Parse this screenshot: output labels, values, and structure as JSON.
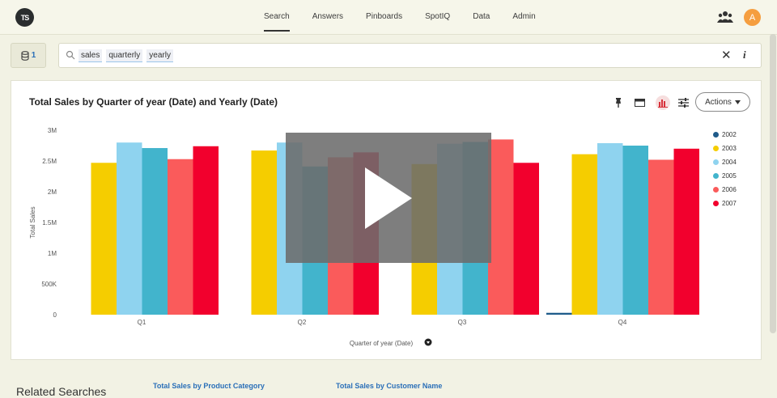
{
  "nav": {
    "logo": "TS",
    "tabs": [
      {
        "label": "Search",
        "active": true
      },
      {
        "label": "Answers",
        "active": false
      },
      {
        "label": "Pinboards",
        "active": false
      },
      {
        "label": "SpotIQ",
        "active": false
      },
      {
        "label": "Data",
        "active": false
      },
      {
        "label": "Admin",
        "active": false
      }
    ],
    "avatar_initial": "A"
  },
  "sources": {
    "count": "1"
  },
  "search": {
    "tokens": [
      "sales",
      "quarterly",
      "yearly"
    ]
  },
  "toolbar": {
    "actions_label": "Actions"
  },
  "related": {
    "title": "Related Searches",
    "links": [
      "Total Sales by Product Category",
      "Total Sales by Customer Name"
    ]
  },
  "colors": {
    "accent": "#2a6fb8",
    "avatar": "#f59e3f"
  },
  "chart_data": {
    "type": "bar",
    "title": "Total Sales by Quarter of year (Date) and Yearly (Date)",
    "xlabel": "Quarter of year (Date)",
    "ylabel": "Total Sales",
    "categories": [
      "Q1",
      "Q2",
      "Q3",
      "Q4"
    ],
    "ylim": [
      0,
      3000000
    ],
    "yticks": [
      0,
      500000,
      1000000,
      1500000,
      2000000,
      2500000,
      3000000
    ],
    "ytick_labels": [
      "0",
      "500K",
      "1M",
      "1.5M",
      "2M",
      "2.5M",
      "3M"
    ],
    "legend_position": "right",
    "series": [
      {
        "name": "2002",
        "color": "#1f5b8a",
        "values": [
          0,
          0,
          0,
          30000
        ]
      },
      {
        "name": "2003",
        "color": "#f5cd00",
        "values": [
          2470000,
          2670000,
          2450000,
          2610000
        ]
      },
      {
        "name": "2004",
        "color": "#8fd3ef",
        "values": [
          2800000,
          2800000,
          2780000,
          2790000
        ]
      },
      {
        "name": "2005",
        "color": "#42b4cc",
        "values": [
          2710000,
          2410000,
          2810000,
          2750000
        ]
      },
      {
        "name": "2006",
        "color": "#fa5b5b",
        "values": [
          2530000,
          2560000,
          2850000,
          2520000
        ]
      },
      {
        "name": "2007",
        "color": "#f2002d",
        "values": [
          2740000,
          2640000,
          2470000,
          2700000
        ]
      }
    ]
  }
}
